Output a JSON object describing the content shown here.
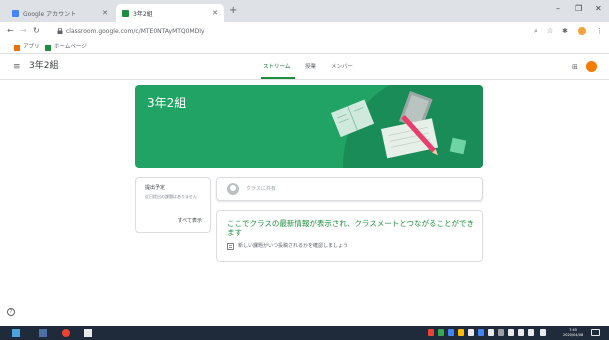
{
  "browser": {
    "tabs": [
      {
        "title": "Google アカウント",
        "favicon_color": "#4285f4"
      },
      {
        "title": "3年2組",
        "favicon_color": "#1e8e3e"
      }
    ],
    "url": "classroom.google.com/c/MTE0NTAyMTQ0MDIy",
    "bookmarks": [
      {
        "label": "アプリ",
        "color": "#e8710a"
      },
      {
        "label": "ホームページ",
        "color": "#1e8e3e"
      }
    ]
  },
  "classroom": {
    "class_name": "3年2組",
    "tabs": [
      "ストリーム",
      "授業",
      "メンバー"
    ],
    "active_tab": 0,
    "accent_color": "#1e8e3e",
    "banner_color": "#21a366"
  },
  "upcoming": {
    "title": "提出予定",
    "description": "近日提出の課題はありません",
    "view_all": "すべて表示"
  },
  "share": {
    "placeholder": "クラスに共有"
  },
  "stream": {
    "message": "ここでクラスの最新情報が表示され、クラスメートとつながることができます",
    "sub": "新しい課題がいつ投稿されるかを確認しましょう"
  },
  "taskbar": {
    "time": "7:45",
    "date": "2020/04/08"
  }
}
